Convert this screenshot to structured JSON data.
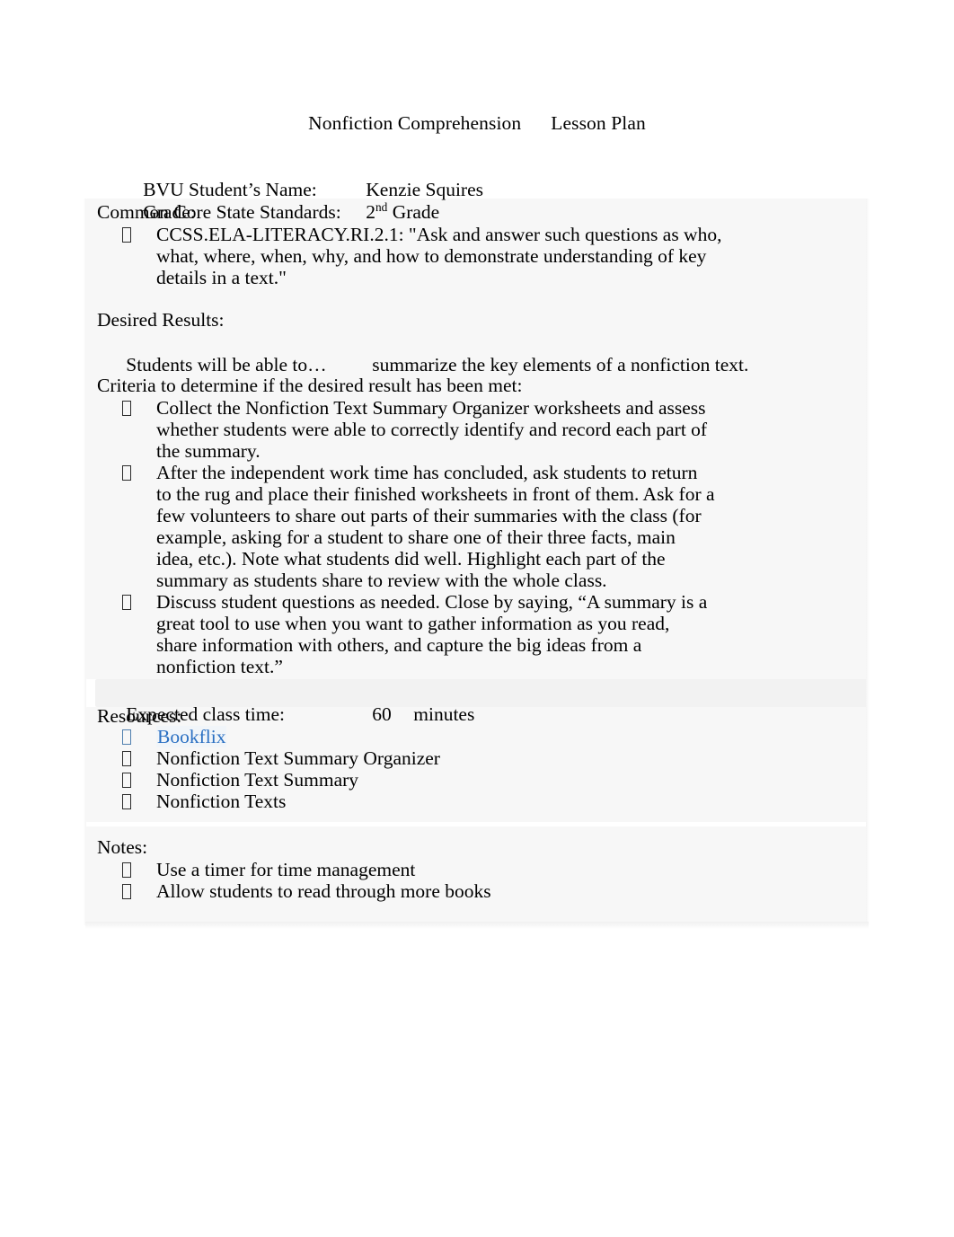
{
  "document": {
    "title_main": "Nonfiction Comprehension",
    "title_sub": "Lesson Plan"
  },
  "header_fields": [
    {
      "label": "BVU Student’s Name:",
      "value": "Kenzie Squires"
    },
    {
      "label": "Grade:",
      "value_prefix": "2",
      "value_sup": "nd",
      "value_suffix": " Grade"
    }
  ],
  "standards": {
    "heading": "Common Core State Standards:",
    "items": [
      "CCSS.ELA-LITERACY.RI.2.1: \"Ask and answer such questions as who, what, where, when, why, and how to demonstrate understanding of key details in a text.\""
    ]
  },
  "desired_results": {
    "heading": "Desired Results:",
    "objective_label": "Students will be able to…",
    "objective_value": "summarize the key elements of a nonfiction text."
  },
  "criteria": {
    "heading": "Criteria to determine if the desired result has been met:",
    "items": [
      "Collect the Nonfiction Text Summary Organizer worksheets and assess whether students were able to correctly identify and record each part of the summary.",
      "After the independent work time has concluded, ask students to return to the rug and place their finished worksheets in front of them. Ask for a few volunteers to share out parts of their summaries with the class (for example, asking for a student to share one of their three facts, main idea, etc.). Note what students did well. Highlight each part of the summary as students share to review with the whole class.",
      "Discuss student questions as needed. Close by saying, “A summary is a great tool to use when you want to gather information as you read, share information with others, and capture the big ideas from a nonfiction text.”"
    ]
  },
  "class_time": {
    "label": "Expected class time:",
    "value": "60",
    "unit": "minutes"
  },
  "resources": {
    "heading": "Resources:",
    "items": [
      {
        "text": "Bookflix",
        "is_link": true
      },
      {
        "text": "Nonfiction Text Summary Organizer",
        "is_link": false
      },
      {
        "text": "Nonfiction Text Summary",
        "is_link": false
      },
      {
        "text": "Nonfiction Texts",
        "is_link": false
      }
    ]
  },
  "notes": {
    "heading": "Notes:",
    "items": [
      "Use a timer for time management",
      "Allow students to read through more books"
    ]
  },
  "icons": {
    "bullet_marker": "missing-glyph-box-icon"
  },
  "colors": {
    "link": "#2a6fc2",
    "text": "#000000",
    "panel_shade": "#f7f7f7"
  }
}
